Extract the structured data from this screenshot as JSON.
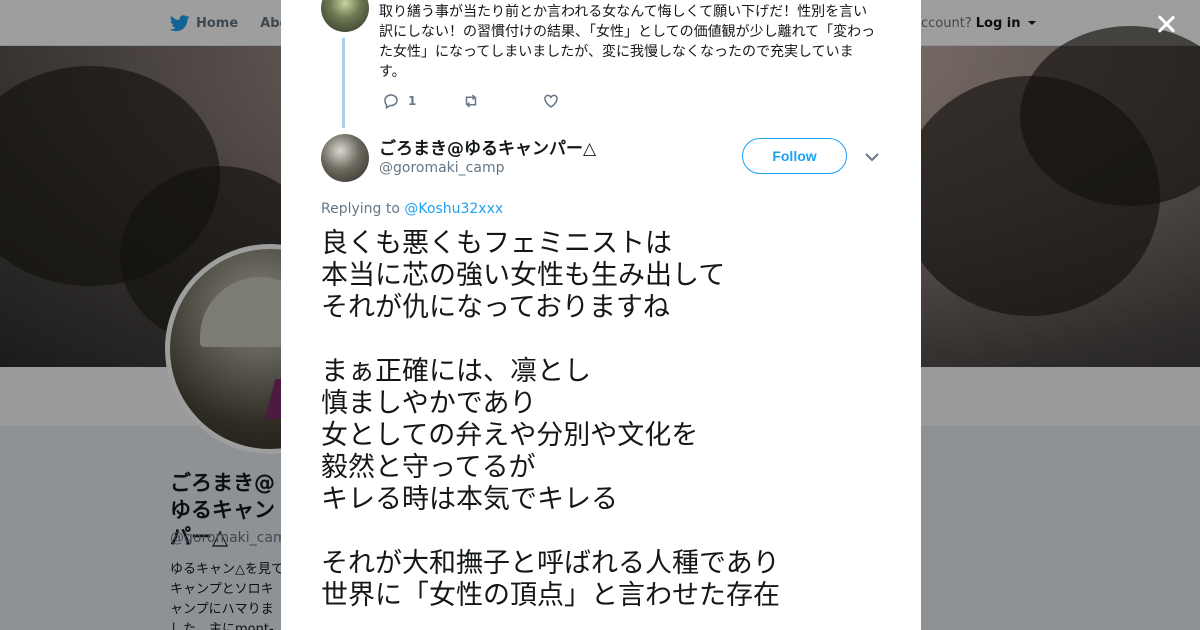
{
  "nav": {
    "home_label": "Home",
    "about_label": "Abo",
    "account_prompt": "ccount?",
    "login_label": "Log in"
  },
  "profile": {
    "name": "ごろまき@ゆるキャンパー△",
    "handle": "@goromaki_camp",
    "bio": "ゆるキャン△を見てキャンプとソロキャンプにハマりました。主にmont-bell"
  },
  "previous_tweet": {
    "text": "取り繕う事が当たり前とか言われる女なんて悔しくて願い下げだ！性別を言い訳にしない！の習慣付けの結果、「女性」としての価値観が少し離れて「変わった女性」になってしまいましたが、変に我慢しなくなったので充実しています。",
    "reply_count": "1"
  },
  "tweet": {
    "author_name": "ごろまき@ゆるキャンパー△",
    "author_handle": "@goromaki_camp",
    "follow_label": "Follow",
    "replying_prefix": "Replying to",
    "replying_handle": "@Koshu32xxx",
    "paragraphs": [
      [
        "良くも悪くもフェミニストは",
        "本当に芯の強い女性も生み出して",
        "それが仇になっておりますね"
      ],
      [
        "まぁ正確には、凛とし",
        "慎ましやかであり",
        "女としての弁えや分別や文化を",
        "毅然と守ってるが",
        "キレる時は本気でキレる"
      ],
      [
        "それが大和撫子と呼ばれる人種であり",
        "世界に「女性の頂点」と言わせた存在"
      ]
    ]
  },
  "colors": {
    "accent": "#1da1f2",
    "thread_line": "#a9d1ef",
    "text": "#14171a",
    "muted": "#657786"
  }
}
